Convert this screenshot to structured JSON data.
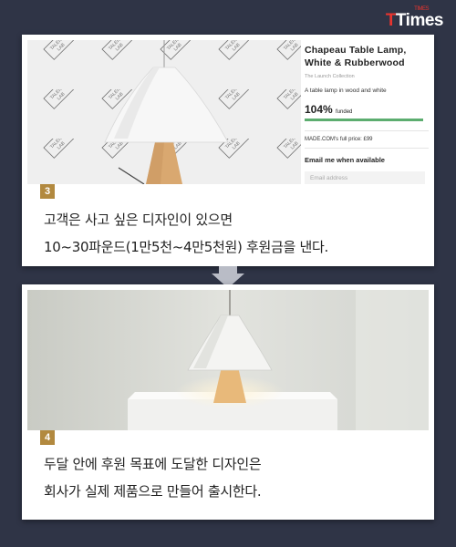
{
  "brand": {
    "logo_t": "T",
    "logo_rest": "Times",
    "logo_sup": "TIMES"
  },
  "cards": [
    {
      "number": "3",
      "caption_lines": [
        "고객은 사고 싶은 디자인이 있으면",
        "10~30파운드(1만5천~4만5천원) 후원금을 낸다."
      ],
      "watermark": [
        "TALENT",
        "LAB"
      ],
      "product": {
        "title_line1": "Chapeau Table Lamp,",
        "title_line2": "White & Rubberwood",
        "collection": "The Launch Collection",
        "description": "A table lamp in wood and white",
        "funded_percent": "104%",
        "funded_label": "funded",
        "funded_fraction": 1.0,
        "price": "MADE.COM's full price: £99",
        "email_title": "Email me when available",
        "email_placeholder": "Email address"
      }
    },
    {
      "number": "4",
      "caption_lines": [
        "두달 안에 후원 목표에 도달한 디자인은",
        "회사가 실제 제품으로 만들어 출시한다."
      ]
    }
  ],
  "colors": {
    "background": "#2f3446",
    "badge": "#b2893f",
    "progress": "#5cad6f",
    "accent": "#e8342f"
  }
}
